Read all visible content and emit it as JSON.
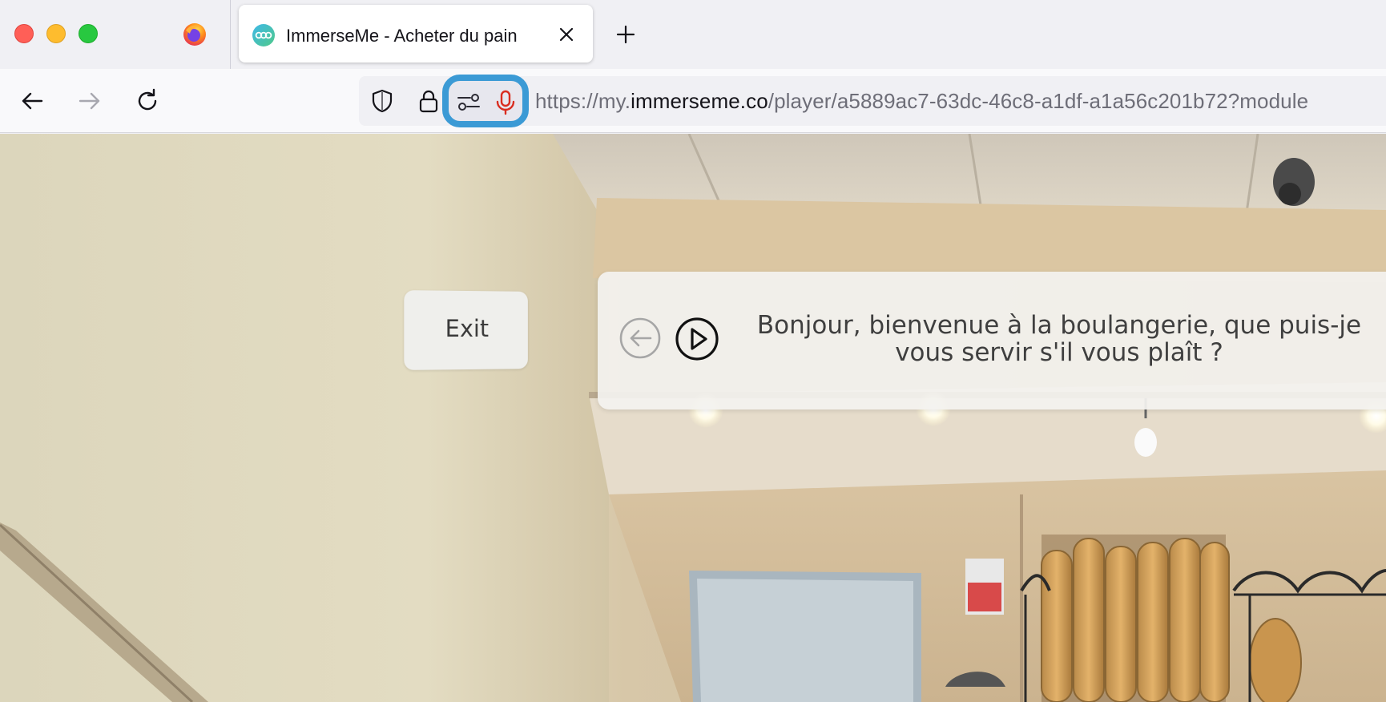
{
  "browser": {
    "tab": {
      "title": "ImmerseMe - Acheter du pain"
    },
    "url": {
      "prefix": "https://my.",
      "host": "immerseme.co",
      "path": "/player/a5889ac7-63dc-46c8-a1df-a1a56c201b72?module"
    },
    "colors": {
      "permission_highlight": "#3b9ad5",
      "mic_icon": "#d92d20"
    },
    "icons": [
      "firefox-icon",
      "immerseme-favicon",
      "close-icon",
      "plus-icon",
      "back-arrow-icon",
      "forward-arrow-icon",
      "reload-icon",
      "shield-icon",
      "lock-icon",
      "permissions-settings-icon",
      "microphone-icon"
    ]
  },
  "page": {
    "exit_label": "Exit",
    "dialog": {
      "text": "Bonjour, bienvenue à la boulangerie, que puis-je vous servir s'il vous plaît ?",
      "icons": [
        "back-circle-icon",
        "play-circle-icon"
      ]
    }
  }
}
